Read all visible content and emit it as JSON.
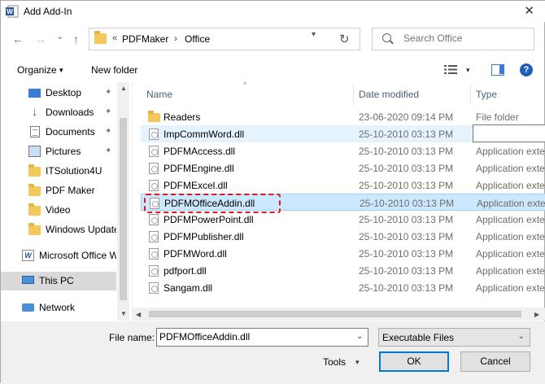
{
  "window": {
    "title": "Add Add-In",
    "close_glyph": "✕"
  },
  "nav": {
    "back": "←",
    "forward": "→",
    "dropdown": "⌄",
    "up": "↑",
    "refresh": "↻"
  },
  "address": {
    "chevrons": "«",
    "parts": [
      "PDFMaker",
      "Office"
    ],
    "separator": "›"
  },
  "search": {
    "placeholder": "Search Office"
  },
  "toolbar": {
    "organize": "Organize",
    "organize_dd": "▾",
    "new_folder": "New folder",
    "view_dd": "▾",
    "help": "?"
  },
  "sidebar": {
    "items": [
      {
        "label": "Desktop",
        "icon": "desktop-icon",
        "pinned": true
      },
      {
        "label": "Downloads",
        "icon": "download-icon",
        "pinned": true
      },
      {
        "label": "Documents",
        "icon": "documents-icon",
        "pinned": true
      },
      {
        "label": "Pictures",
        "icon": "pictures-icon",
        "pinned": true
      },
      {
        "label": "ITSolution4U",
        "icon": "folder-icon",
        "pinned": false
      },
      {
        "label": "PDF Maker",
        "icon": "folder-icon",
        "pinned": false
      },
      {
        "label": "Video",
        "icon": "folder-icon",
        "pinned": false
      },
      {
        "label": "Windows Update",
        "icon": "folder-icon",
        "pinned": false
      },
      {
        "label": "Microsoft Office W",
        "icon": "word-icon",
        "pinned": false
      },
      {
        "label": "This PC",
        "icon": "computer-icon",
        "pinned": false,
        "selected": true
      },
      {
        "label": "Network",
        "icon": "network-icon",
        "pinned": false
      }
    ],
    "pin_glyph": "📌"
  },
  "columns": {
    "name": "Name",
    "date": "Date modified",
    "type": "Type",
    "sort_glyph": "^"
  },
  "files": [
    {
      "name": "Readers",
      "date": "23-06-2020 09:14 PM",
      "type": "File folder",
      "kind": "folder"
    },
    {
      "name": "ImpCommWord.dll",
      "date": "25-10-2010 03:13 PM",
      "type": "Application exte",
      "kind": "dll"
    },
    {
      "name": "PDFMAccess.dll",
      "date": "25-10-2010 03:13 PM",
      "type": "Application exte",
      "kind": "dll"
    },
    {
      "name": "PDFMEngine.dll",
      "date": "25-10-2010 03:13 PM",
      "type": "Application exte",
      "kind": "dll"
    },
    {
      "name": "PDFMExcel.dll",
      "date": "25-10-2010 03:13 PM",
      "type": "Application exte",
      "kind": "dll"
    },
    {
      "name": "PDFMOfficeAddin.dll",
      "date": "25-10-2010 03:13 PM",
      "type": "Application exte",
      "kind": "dll"
    },
    {
      "name": "PDFMPowerPoint.dll",
      "date": "25-10-2010 03:13 PM",
      "type": "Application exte",
      "kind": "dll"
    },
    {
      "name": "PDFMPublisher.dll",
      "date": "25-10-2010 03:13 PM",
      "type": "Application exte",
      "kind": "dll"
    },
    {
      "name": "PDFMWord.dll",
      "date": "25-10-2010 03:13 PM",
      "type": "Application exte",
      "kind": "dll"
    },
    {
      "name": "pdfport.dll",
      "date": "25-10-2010 03:13 PM",
      "type": "Application exte",
      "kind": "dll"
    },
    {
      "name": "Sangam.dll",
      "date": "25-10-2010 03:13 PM",
      "type": "Application exte",
      "kind": "dll"
    }
  ],
  "bottom": {
    "filename_label": "File name:",
    "filename_value": "PDFMOfficeAddin.dll",
    "filetype_value": "Executable Files",
    "dd_glyph": "⌄",
    "tools_label": "Tools",
    "tools_dd": "▾",
    "ok_label": "OK",
    "cancel_label": "Cancel"
  },
  "scroll": {
    "up": "▲",
    "down": "▼",
    "left": "◀",
    "right": "▶"
  },
  "colors": {
    "highlight": "#e8141c",
    "selection": "#cce8ff",
    "accent": "#0078d7"
  }
}
